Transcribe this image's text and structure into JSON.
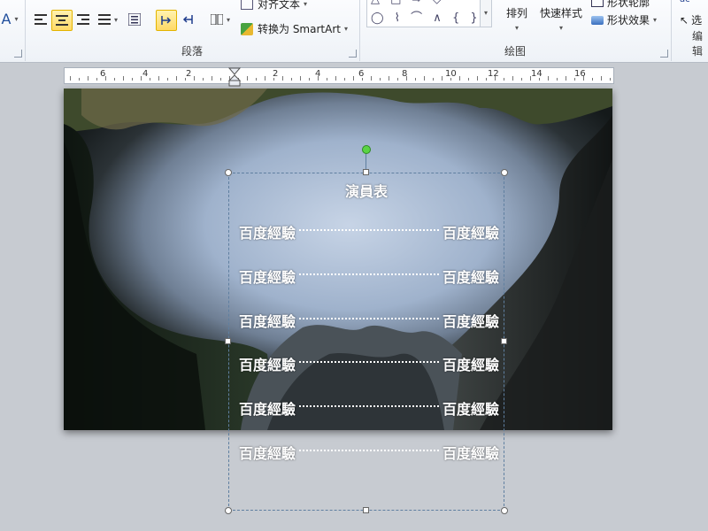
{
  "ribbon": {
    "paragraph_group_label": "段落",
    "drawing_group_label": "绘图",
    "edit_group_label": "编辑",
    "align_text_label": "对齐文本",
    "convert_smartart_label": "转换为 SmartArt",
    "arrange_label": "排列",
    "quick_styles_label": "快速样式",
    "shape_outline_label": "形状轮廓",
    "shape_effects_label": "形状效果",
    "select_label": "选"
  },
  "ruler": {
    "numbers": [
      "6",
      "4",
      "2",
      "2",
      "4",
      "6",
      "8",
      "10",
      "12",
      "14",
      "16"
    ]
  },
  "slide": {
    "title": "演員表",
    "rows": [
      {
        "left": "百度經驗",
        "right": "百度經驗"
      },
      {
        "left": "百度經驗",
        "right": "百度經驗"
      },
      {
        "left": "百度經驗",
        "right": "百度經驗"
      },
      {
        "left": "百度經驗",
        "right": "百度經驗"
      },
      {
        "left": "百度經驗",
        "right": "百度經驗"
      },
      {
        "left": "百度經驗",
        "right": "百度經驗"
      }
    ]
  }
}
